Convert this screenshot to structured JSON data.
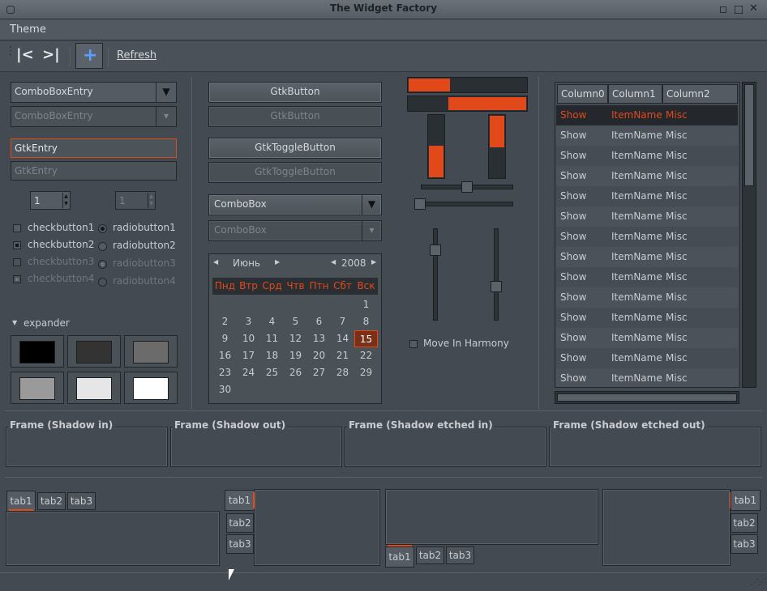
{
  "window": {
    "title": "The Widget Factory"
  },
  "menu": {
    "theme": "Theme"
  },
  "toolbar": {
    "refresh": "Refresh"
  },
  "colors": {
    "accent": "#e2491a",
    "background": "#434a52"
  },
  "left": {
    "combo_entry": "ComboBoxEntry",
    "combo_entry_disabled": "ComboBoxEntry",
    "entry": "GtkEntry",
    "entry_disabled": "GtkEntry",
    "spin1": "1",
    "spin2": "1",
    "checks": [
      {
        "label": "checkbutton1",
        "checked": false,
        "disabled": false
      },
      {
        "label": "checkbutton2",
        "checked": true,
        "disabled": false
      },
      {
        "label": "checkbutton3",
        "checked": false,
        "disabled": true
      },
      {
        "label": "checkbutton4",
        "checked": true,
        "disabled": true
      }
    ],
    "radios": [
      {
        "label": "radiobutton1",
        "checked": true,
        "disabled": false
      },
      {
        "label": "radiobutton2",
        "checked": false,
        "disabled": false
      },
      {
        "label": "radiobutton3",
        "checked": true,
        "disabled": true
      },
      {
        "label": "radiobutton4",
        "checked": false,
        "disabled": true
      }
    ],
    "expander": "expander",
    "swatches": [
      "#000000",
      "#333333",
      "#6b6b6b",
      "#9a9a9a",
      "#e6e6e6",
      "#ffffff"
    ]
  },
  "middle": {
    "button": "GtkButton",
    "button_disabled": "GtkButton",
    "toggle": "GtkToggleButton",
    "toggle_disabled": "GtkToggleButton",
    "combo": "ComboBox",
    "combo_disabled": "ComboBox",
    "calendar": {
      "month": "Июнь",
      "year": "2008",
      "weekdays": [
        "Пнд",
        "Втр",
        "Срд",
        "Чтв",
        "Птн",
        "Сбт",
        "Вск"
      ],
      "days": [
        [
          "",
          "",
          "",
          "",
          "",
          "",
          "1"
        ],
        [
          "2",
          "3",
          "4",
          "5",
          "6",
          "7",
          "8"
        ],
        [
          "9",
          "10",
          "11",
          "12",
          "13",
          "14",
          "15"
        ],
        [
          "16",
          "17",
          "18",
          "19",
          "20",
          "21",
          "22"
        ],
        [
          "23",
          "24",
          "25",
          "26",
          "27",
          "28",
          "29"
        ],
        [
          "30",
          "",
          "",
          "",
          "",
          "",
          ""
        ]
      ],
      "selected": "15"
    }
  },
  "sliders": {
    "progress_h1": 0.35,
    "progress_h2": 0.35,
    "progress_v1": 0.5,
    "progress_v2": 0.5,
    "scale_h1": 0.5,
    "scale_h2": 0.0,
    "scale_v1": 0.2,
    "scale_v2": 0.65,
    "harmony": "Move In Harmony"
  },
  "tree": {
    "columns": [
      "Column0",
      "Column1",
      "Column2"
    ],
    "rows": [
      [
        "Show",
        "ItemName",
        "Misc"
      ],
      [
        "Show",
        "ItemName",
        "Misc"
      ],
      [
        "Show",
        "ItemName",
        "Misc"
      ],
      [
        "Show",
        "ItemName",
        "Misc"
      ],
      [
        "Show",
        "ItemName",
        "Misc"
      ],
      [
        "Show",
        "ItemName",
        "Misc"
      ],
      [
        "Show",
        "ItemName",
        "Misc"
      ],
      [
        "Show",
        "ItemName",
        "Misc"
      ],
      [
        "Show",
        "ItemName",
        "Misc"
      ],
      [
        "Show",
        "ItemName",
        "Misc"
      ],
      [
        "Show",
        "ItemName",
        "Misc"
      ],
      [
        "Show",
        "ItemName",
        "Misc"
      ],
      [
        "Show",
        "ItemName",
        "Misc"
      ],
      [
        "Show",
        "ItemName",
        "Misc"
      ]
    ]
  },
  "frames": [
    "Frame (Shadow in)",
    "Frame (Shadow out)",
    "Frame (Shadow etched in)",
    "Frame (Shadow etched out)"
  ],
  "tabs": [
    "tab1",
    "tab2",
    "tab3"
  ]
}
